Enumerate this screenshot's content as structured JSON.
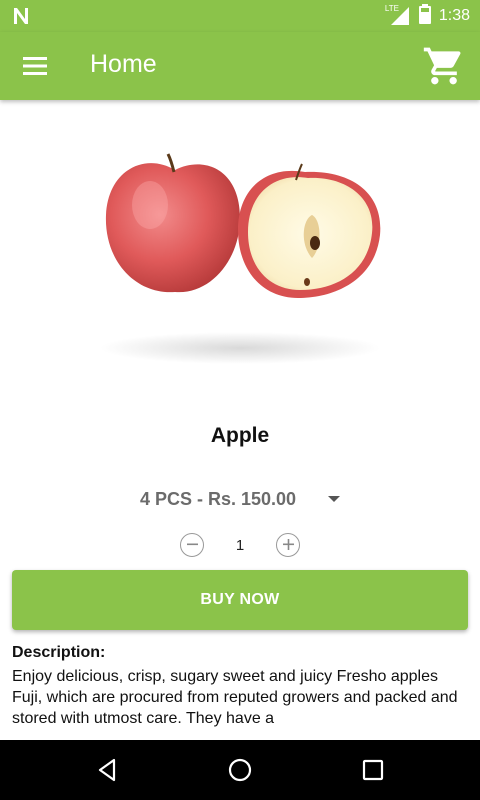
{
  "status_bar": {
    "time": "1:38",
    "network_label": "LTE"
  },
  "header": {
    "title": "Home"
  },
  "product": {
    "name": "Apple",
    "selected_variant": "4 PCS - Rs. 150.00",
    "quantity": "1",
    "buy_label": "BUY NOW"
  },
  "description": {
    "heading": "Description:",
    "text": "Enjoy delicious, crisp, sugary sweet and juicy Fresho apples Fuji, which are procured from reputed growers and packed and stored with utmost care. They have a"
  },
  "icons": {
    "status": [
      "n-notification-icon",
      "signal-icon",
      "battery-icon"
    ],
    "app_bar": [
      "menu-icon",
      "cart-icon"
    ],
    "quantity": [
      "minus-icon",
      "plus-icon"
    ],
    "nav": [
      "back-icon",
      "home-icon",
      "recents-icon"
    ]
  },
  "colors": {
    "primary": "#8bc34a",
    "nav_bar": "#000000"
  }
}
